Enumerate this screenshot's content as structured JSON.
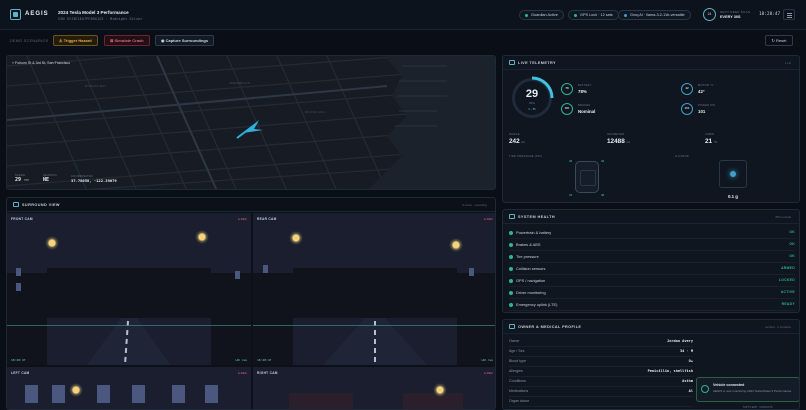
{
  "header": {
    "brand": "AEGIS",
    "vehicle_title": "2024 Tesla Model 3 Performance",
    "vehicle_sub": "VIN 5YJ3E1EA7PF89X123 · Midnight Silver",
    "status_pills": [
      {
        "label": "Guardian Active",
        "color": "#2fb38f"
      },
      {
        "label": "GPS Lock · 12 sats",
        "color": "#2fb38f"
      },
      {
        "label": "Groq AI · llama-3.2-11b-versatile",
        "color": "#3f9fc9"
      }
    ],
    "scan_ring": "24",
    "scan_label": "NEXT DEEP SCAN",
    "scan_value": "EVERY 30S",
    "clock": "18:28:47"
  },
  "actions": {
    "demo_label": "DEMO SCENARIOS",
    "trigger_hazard": "Trigger Hazard",
    "simulate_crash": "Simulate Crash",
    "capture": "Capture Surroundings",
    "reset": "Reset"
  },
  "map": {
    "location": "Folsom St & 3rd St, San Francisco",
    "district_labels": [
      "MISSION BAY",
      "RINCON HILL",
      "TENDERLOIN"
    ],
    "speed_label": "SPEED",
    "speed_value": "29",
    "speed_unit": "MPH",
    "heading_label": "HEADING",
    "heading_value": "NE",
    "coords_label": "COORDINATES",
    "coords_value": "37.78058, -122.39679"
  },
  "surround": {
    "title": "SURROUND VIEW",
    "meta": "4 cams · recording",
    "cams": [
      {
        "label": "FRONT CAM",
        "rec": "● REC",
        "time": "18:28:47",
        "quality": "HD · live"
      },
      {
        "label": "REAR CAM",
        "rec": "● REC",
        "time": "18:28:47",
        "quality": "HD · live"
      },
      {
        "label": "LEFT CAM",
        "rec": "● REC"
      },
      {
        "label": "RIGHT CAM",
        "rec": "● REC"
      }
    ]
  },
  "telemetry": {
    "title": "LIVE TELEMETRY",
    "meta": "1 Hz",
    "speed": "29",
    "speed_unit": "MPH",
    "speed_range": "0 – 85",
    "battery_ring": "78",
    "battery_label": "BATTERY",
    "battery_value": "78%",
    "brakes_ring": "OK",
    "brakes_label": "BRAKES",
    "brakes_value": "Nominal",
    "motor_ring": "42",
    "motor_label": "MOTOR °C",
    "motor_value": "42°",
    "power_ring": "101",
    "power_label": "POWER KW",
    "power_value": "101",
    "range_label": "RANGE",
    "range_value": "242",
    "range_unit": "mi",
    "odo_label": "ODOMETER",
    "odo_value": "12488",
    "odo_unit": "mi",
    "cabin_label": "CABIN",
    "cabin_value": "21",
    "cabin_unit": "°C",
    "tire_label": "TIRE PRESSURE (PSI)",
    "tires": [
      "42",
      "42",
      "41",
      "42"
    ],
    "gforce_label": "G-FORCE",
    "gforce_value": "0.1 g"
  },
  "health": {
    "title": "SYSTEM HEALTH",
    "meta": "8/8 nominal",
    "items": [
      {
        "name": "Powertrain & battery",
        "status": "OK"
      },
      {
        "name": "Brakes & ABS",
        "status": "OK"
      },
      {
        "name": "Tire pressure",
        "status": "OK"
      },
      {
        "name": "Collision sensors",
        "status": "ARMED"
      },
      {
        "name": "GPS / navigation",
        "status": "LOCKED"
      },
      {
        "name": "Driver monitoring",
        "status": "ACTIVE"
      },
      {
        "name": "Emergency uplink (LTE)",
        "status": "READY"
      }
    ]
  },
  "owner": {
    "title": "OWNER & MEDICAL PROFILE",
    "meta": "verified · 2 contacts",
    "rows": [
      {
        "name": "Owner",
        "value": "Jordan Avery"
      },
      {
        "name": "Age / Sex",
        "value": "34 · M"
      },
      {
        "name": "Blood type",
        "value": "O+"
      },
      {
        "name": "Allergies",
        "value": "Penicillin, shellfish"
      },
      {
        "name": "Conditions",
        "value": "Asthm"
      },
      {
        "name": "Medications",
        "value": "Al"
      },
      {
        "name": "Organ donor",
        "value": ""
      }
    ],
    "toast_title": "Vehicle connected",
    "toast_body": "AEGIS is now monitoring 2024 Tesla Model 3 Performance.",
    "footer": "TAP TO EDIT · CONTACTS"
  }
}
